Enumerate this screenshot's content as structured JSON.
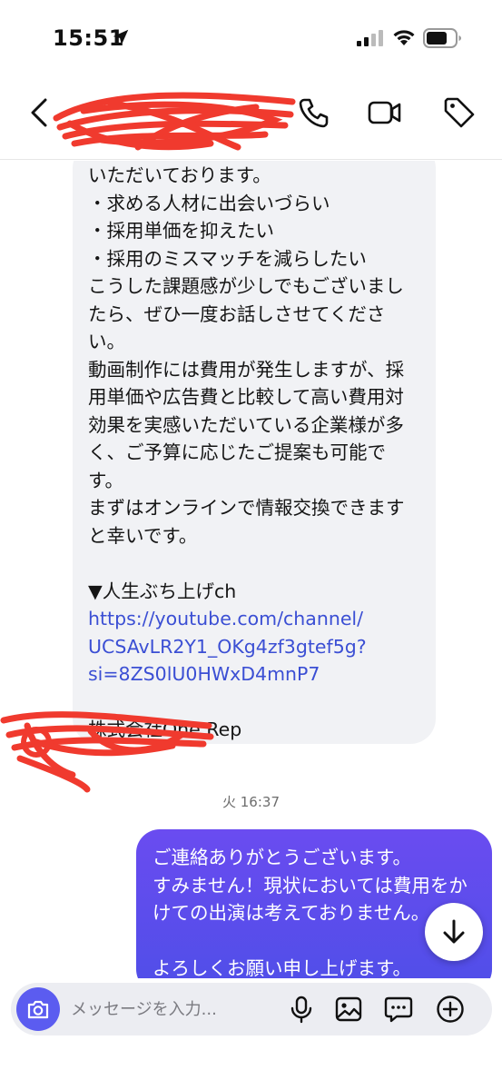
{
  "status_bar": {
    "time": "15:51"
  },
  "chat": {
    "incoming_lines": [
      "いただいております。",
      "・求める人材に出会いづらい",
      "・採用単価を抑えたい",
      "・採用のミスマッチを減らしたい",
      "こうした課題感が少しでもございまし",
      "たら、ぜひ一度お話しさせてくださ",
      "い。",
      "動画制作には費用が発生しますが、採",
      "用単価や広告費と比較して高い費用対",
      "効果を実感いただいている企業様が多",
      "く、ご予算に応じたご提案も可能で",
      "す。",
      "まずはオンラインで情報交換できます",
      "と幸いです。"
    ],
    "channel_label": "▼人生ぶち上げch",
    "link_lines": [
      "https://youtube.com/channel/",
      "UCSAvLR2Y1_OKg4zf3gtef5g?",
      "si=8ZS0lU0HWxD4mnP7"
    ],
    "company": "株式会社One Rep",
    "timestamp": "火 16:37",
    "outgoing_lines": [
      "ご連絡ありがとうございます。",
      "すみません！現状においては費用をか",
      "けての出演は考えておりません。",
      "",
      "よろしくお願い申し上げます。"
    ]
  },
  "composer": {
    "placeholder": "メッセージを入力..."
  },
  "colors": {
    "accent": "#5b5cf0",
    "outgoing_bubble": "#5a4ef0",
    "link": "#3b4fd4",
    "incoming_bubble": "#f1f2f5",
    "redaction": "#f03a2e"
  },
  "icons": [
    "location-arrow-icon",
    "signal-icon",
    "wifi-icon",
    "battery-icon",
    "back-chevron-icon",
    "phone-icon",
    "video-icon",
    "tag-icon",
    "arrow-down-icon",
    "camera-icon",
    "mic-icon",
    "image-icon",
    "chat-bubble-icon",
    "plus-circle-icon"
  ]
}
